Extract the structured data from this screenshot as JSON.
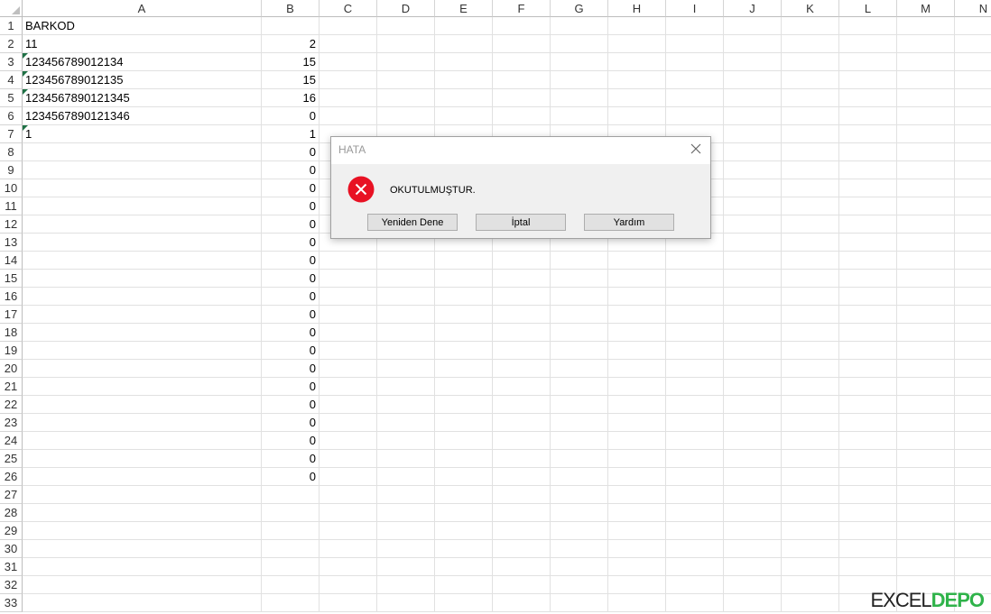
{
  "columns": [
    "A",
    "B",
    "C",
    "D",
    "E",
    "F",
    "G",
    "H",
    "I",
    "J",
    "K",
    "L",
    "M",
    "N"
  ],
  "rows": [
    {
      "n": "1",
      "a": "BARKOD",
      "b": "",
      "flag": false
    },
    {
      "n": "2",
      "a": "11",
      "b": "2",
      "flag": false
    },
    {
      "n": "3",
      "a": "123456789012134",
      "b": "15",
      "flag": true
    },
    {
      "n": "4",
      "a": "123456789012135",
      "b": "15",
      "flag": true
    },
    {
      "n": "5",
      "a": "1234567890121345",
      "b": "16",
      "flag": true
    },
    {
      "n": "6",
      "a": "1234567890121346",
      "b": "0",
      "flag": false
    },
    {
      "n": "7",
      "a": "1",
      "b": "1",
      "flag": true
    },
    {
      "n": "8",
      "a": "",
      "b": "0",
      "flag": false
    },
    {
      "n": "9",
      "a": "",
      "b": "0",
      "flag": false
    },
    {
      "n": "10",
      "a": "",
      "b": "0",
      "flag": false
    },
    {
      "n": "11",
      "a": "",
      "b": "0",
      "flag": false
    },
    {
      "n": "12",
      "a": "",
      "b": "0",
      "flag": false
    },
    {
      "n": "13",
      "a": "",
      "b": "0",
      "flag": false
    },
    {
      "n": "14",
      "a": "",
      "b": "0",
      "flag": false
    },
    {
      "n": "15",
      "a": "",
      "b": "0",
      "flag": false
    },
    {
      "n": "16",
      "a": "",
      "b": "0",
      "flag": false
    },
    {
      "n": "17",
      "a": "",
      "b": "0",
      "flag": false
    },
    {
      "n": "18",
      "a": "",
      "b": "0",
      "flag": false
    },
    {
      "n": "19",
      "a": "",
      "b": "0",
      "flag": false
    },
    {
      "n": "20",
      "a": "",
      "b": "0",
      "flag": false
    },
    {
      "n": "21",
      "a": "",
      "b": "0",
      "flag": false
    },
    {
      "n": "22",
      "a": "",
      "b": "0",
      "flag": false
    },
    {
      "n": "23",
      "a": "",
      "b": "0",
      "flag": false
    },
    {
      "n": "24",
      "a": "",
      "b": "0",
      "flag": false
    },
    {
      "n": "25",
      "a": "",
      "b": "0",
      "flag": false
    },
    {
      "n": "26",
      "a": "",
      "b": "0",
      "flag": false
    },
    {
      "n": "27",
      "a": "",
      "b": "",
      "flag": false
    },
    {
      "n": "28",
      "a": "",
      "b": "",
      "flag": false
    },
    {
      "n": "29",
      "a": "",
      "b": "",
      "flag": false
    },
    {
      "n": "30",
      "a": "",
      "b": "",
      "flag": false
    },
    {
      "n": "31",
      "a": "",
      "b": "",
      "flag": false
    },
    {
      "n": "32",
      "a": "",
      "b": "",
      "flag": false
    },
    {
      "n": "33",
      "a": "",
      "b": "",
      "flag": false
    }
  ],
  "dialog": {
    "title": "HATA",
    "message": "OKUTULMUŞTUR.",
    "icon": "error-icon",
    "buttons": {
      "retry": "Yeniden Dene",
      "cancel": "İptal",
      "help": "Yardım"
    }
  },
  "watermark": {
    "left": "EXCEL",
    "right": "DEPO"
  },
  "colors": {
    "error_red": "#e81123",
    "number_flag": "#1e7145",
    "grid": "#e1e1e1"
  }
}
